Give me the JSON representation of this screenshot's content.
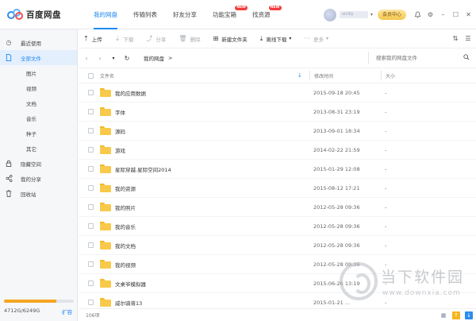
{
  "app": {
    "name": "百度网盘"
  },
  "nav": [
    {
      "label": "我的网盘",
      "active": true,
      "badge": ""
    },
    {
      "label": "传输列表",
      "active": false,
      "badge": ""
    },
    {
      "label": "好友分享",
      "active": false,
      "badge": ""
    },
    {
      "label": "功能宝箱",
      "active": false,
      "badge": "NEW"
    },
    {
      "label": "找资源",
      "active": false,
      "badge": "NEW"
    }
  ],
  "user": {
    "name": "xinlily",
    "vip_label": "会员中心"
  },
  "sidebar": {
    "items": [
      {
        "label": "最近使用",
        "icon": "clock-icon"
      },
      {
        "label": "全部文件",
        "icon": "file-icon"
      },
      {
        "label": "图片"
      },
      {
        "label": "视频"
      },
      {
        "label": "文档"
      },
      {
        "label": "音乐"
      },
      {
        "label": "种子"
      },
      {
        "label": "其它"
      },
      {
        "label": "隐藏空间",
        "icon": "lock-icon"
      },
      {
        "label": "我的分享",
        "icon": "share-icon"
      },
      {
        "label": "回收站",
        "icon": "trash-icon"
      }
    ],
    "quota": {
      "text": "4712G/6249G",
      "used_fraction": 0.754,
      "expand_label": "扩容"
    }
  },
  "toolbar": {
    "upload": "上传",
    "download": "下载",
    "share": "分享",
    "delete": "删除",
    "new_folder": "新建文件夹",
    "offline_download": "离线下载",
    "more": "更多"
  },
  "path": {
    "crumb": "我的网盘",
    "sep": ">",
    "search_placeholder": "搜索我的网盘文件"
  },
  "table": {
    "headers": {
      "name": "文件名",
      "time": "修改时间",
      "size": "大小"
    },
    "rows": [
      {
        "name": "我的应用数据",
        "time": "2015-09-18 20:45",
        "size": "-"
      },
      {
        "name": "字体",
        "time": "2013-08-31 23:19",
        "size": "-"
      },
      {
        "name": "源码",
        "time": "2013-09-01 18:34",
        "size": "-"
      },
      {
        "name": "游戏",
        "time": "2014-02-22 21:59",
        "size": "-"
      },
      {
        "name": "星际穿越.星际空间2014",
        "time": "2015-01-29 12:08",
        "size": "-"
      },
      {
        "name": "我的资源",
        "time": "2015-08-12 17:21",
        "size": "-"
      },
      {
        "name": "我的照片",
        "time": "2012-05-28 09:36",
        "size": "-"
      },
      {
        "name": "我的音乐",
        "time": "2012-05-28 09:36",
        "size": "-"
      },
      {
        "name": "我的文档",
        "time": "2012-05-28 09:36",
        "size": "-"
      },
      {
        "name": "我的视频",
        "time": "2012-05-28 09:36",
        "size": "-"
      },
      {
        "name": "文桌爷模拟器",
        "time": "2015-06-26 13:19",
        "size": "-"
      },
      {
        "name": "威尔骑将13",
        "time": "2015-01-21 ...",
        "size": "-"
      }
    ]
  },
  "status": {
    "count": "106项"
  },
  "watermark": {
    "text": "当下软件园",
    "url": "www.downxia.com"
  }
}
